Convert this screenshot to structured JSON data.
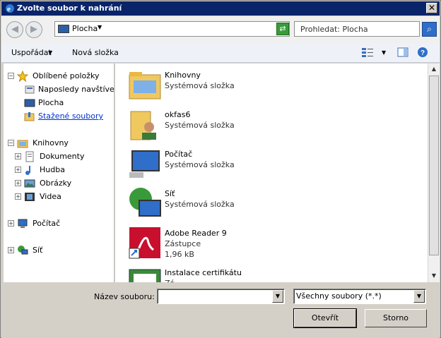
{
  "window": {
    "title": "Zvolte soubor k nahrání"
  },
  "address": {
    "location": "Plocha"
  },
  "search": {
    "placeholder": "Prohledat: Plocha"
  },
  "toolbar": {
    "organize": "Uspořádat",
    "new_folder": "Nová složka"
  },
  "tree": {
    "favorites": "Oblíbené položky",
    "recent": "Naposledy navštívené",
    "desktop": "Plocha",
    "downloads": "Stažené soubory",
    "libraries": "Knihovny",
    "documents": "Dokumenty",
    "music": "Hudba",
    "pictures": "Obrázky",
    "videos": "Videa",
    "computer": "Počítač",
    "network": "Síť"
  },
  "files": [
    {
      "name": "Knihovny",
      "type": "Systémová složka"
    },
    {
      "name": "okfas6",
      "type": "Systémová složka"
    },
    {
      "name": "Počítač",
      "type": "Systémová složka"
    },
    {
      "name": "Síť",
      "type": "Systémová složka"
    },
    {
      "name": "Adobe Reader 9",
      "type": "Zástupce",
      "size": "1,96 kB"
    },
    {
      "name": "Instalace certifikátu",
      "type": "Zá"
    }
  ],
  "footer": {
    "filename_label": "Název souboru:",
    "filename_value": "",
    "filter": "Všechny soubory (*.*)",
    "open": "Otevřít",
    "cancel": "Storno"
  }
}
